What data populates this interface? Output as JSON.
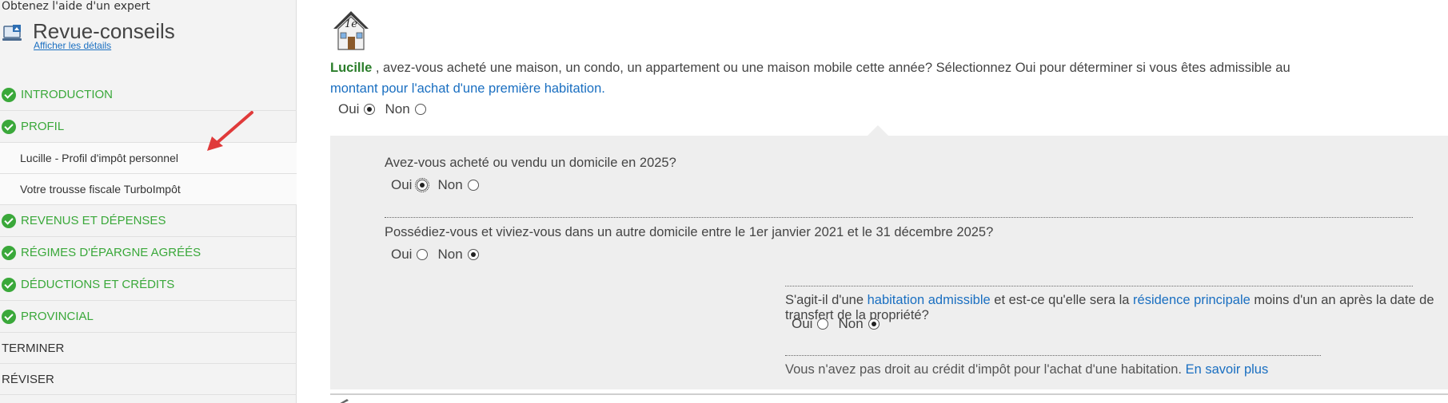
{
  "sidebar": {
    "expert_label": "Obtenez l'aide d'un expert",
    "review_title": "Revue-conseils",
    "review_link": "Afficher les détails",
    "nav": {
      "introduction": "INTRODUCTION",
      "profil": "PROFIL",
      "sub_profil_personnel": "Lucille - Profil d'impôt personnel",
      "sub_trousse": "Votre trousse fiscale TurboImpôt",
      "revenus": "REVENUS ET DÉPENSES",
      "regimes": "RÉGIMES D'ÉPARGNE AGRÉÉS",
      "deductions": "DÉDUCTIONS ET CRÉDITS",
      "provincial": "PROVINCIAL",
      "terminer": "TERMINER",
      "reviser": "RÉVISER"
    }
  },
  "main": {
    "house_badge": "1e",
    "q1": {
      "name": "Lucille",
      "text": " , avez-vous acheté une maison, un condo, un appartement ou une maison mobile cette année? Sélectionnez Oui pour déterminer si vous êtes admissible au ",
      "link": "montant pour l'achat d'une première habitation",
      "end": ".",
      "yes": "Oui",
      "no": "Non",
      "selected": "Oui"
    },
    "q2": {
      "text": "Avez-vous acheté ou vendu un domicile en 2025?",
      "yes": "Oui",
      "no": "Non",
      "selected": "Oui"
    },
    "q3": {
      "text": "Possédiez-vous et viviez-vous dans un autre domicile entre le 1er janvier 2021 et le 31 décembre 2025?",
      "yes": "Oui",
      "no": "Non",
      "selected": "Non"
    },
    "q4": {
      "pre": "S'agit-il d'une ",
      "link1": "habitation admissible",
      "mid": " et est-ce qu'elle sera la ",
      "link2": "résidence principale",
      "post": " moins d'un an après la date de transfert de la propriété?",
      "yes": "Oui",
      "no": "Non",
      "selected": "Non"
    },
    "note": {
      "text": "Vous n'avez pas droit au crédit d'impôt pour l'achat d'une habitation. ",
      "link": "En savoir plus"
    }
  },
  "colors": {
    "accent_green": "#3aa83a",
    "link_blue": "#1a6fc1",
    "arrow_red": "#e03a3a"
  }
}
